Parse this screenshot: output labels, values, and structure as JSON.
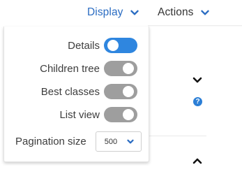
{
  "topbar": {
    "display_label": "Display",
    "actions_label": "Actions"
  },
  "panel": {
    "toggles": [
      {
        "label": "Details",
        "on": true
      },
      {
        "label": "Children tree",
        "on": false
      },
      {
        "label": "Best classes",
        "on": false
      },
      {
        "label": "List view",
        "on": false
      }
    ],
    "pagination": {
      "label": "Pagination size",
      "value": "500"
    }
  },
  "background": {
    "help_icon_text": "?"
  },
  "colors": {
    "accent": "#2f86df",
    "toggle_off": "#9e9e9e",
    "link": "#2a6cc2"
  },
  "icons": {
    "menu_chevron": "chevron-down-icon",
    "select_chevron": "chevron-down-icon",
    "section_toggle_1": "chevron-down-icon",
    "section_toggle_2": "chevron-up-icon",
    "help": "help-icon"
  }
}
